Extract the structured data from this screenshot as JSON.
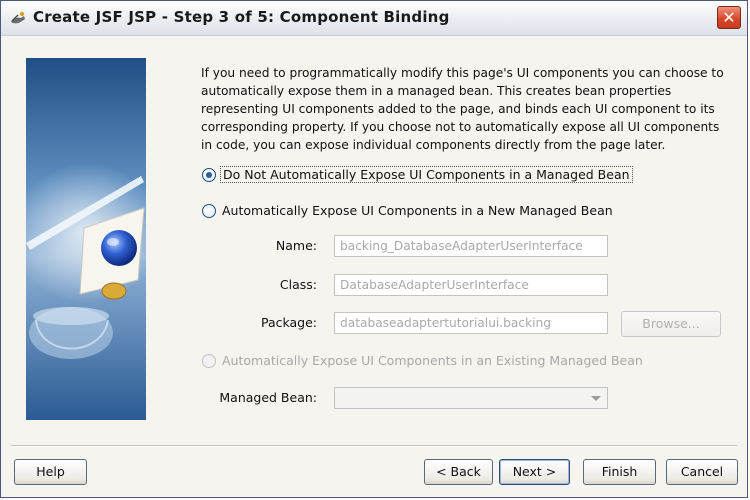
{
  "window": {
    "title": "Create JSF JSP - Step 3 of 5: Component Binding",
    "close_glyph": "✕"
  },
  "intro_text": "If you need to programmatically modify this page's UI components you can choose to automatically expose them in a managed bean. This creates bean properties representing UI components added to the page, and binds each UI component to its corresponding property. If you choose not to automatically expose all UI components in code, you can expose individual components directly from the page later.",
  "options": {
    "do_not_expose": {
      "label": "Do Not Automatically Expose UI Components in a Managed Bean",
      "selected": true
    },
    "new_bean": {
      "label": "Automatically Expose UI Components in a New Managed Bean",
      "selected": false
    },
    "existing_bean": {
      "label": "Automatically Expose UI Components in an Existing Managed Bean",
      "selected": false,
      "enabled": false
    }
  },
  "fields": {
    "name": {
      "label": "Name:",
      "value": "backing_DatabaseAdapterUserInterface"
    },
    "class": {
      "label": "Class:",
      "value": "DatabaseAdapterUserInterface"
    },
    "package": {
      "label": "Package:",
      "value": "databaseadaptertutorialui.backing"
    },
    "browse_label": "Browse...",
    "managed_bean": {
      "label": "Managed Bean:",
      "value": ""
    }
  },
  "buttons": {
    "help": "Help",
    "back": "< Back",
    "next": "Next >",
    "finish": "Finish",
    "cancel": "Cancel"
  },
  "icons": {
    "title": "wizard-icon",
    "close": "close-icon",
    "side_image": "wizard-illustration"
  },
  "colors": {
    "side_image_dark": "#23568e",
    "side_image_light": "#8fb2d6",
    "close_button": "#d8492c",
    "dialog_background": "#f5f4ef"
  }
}
